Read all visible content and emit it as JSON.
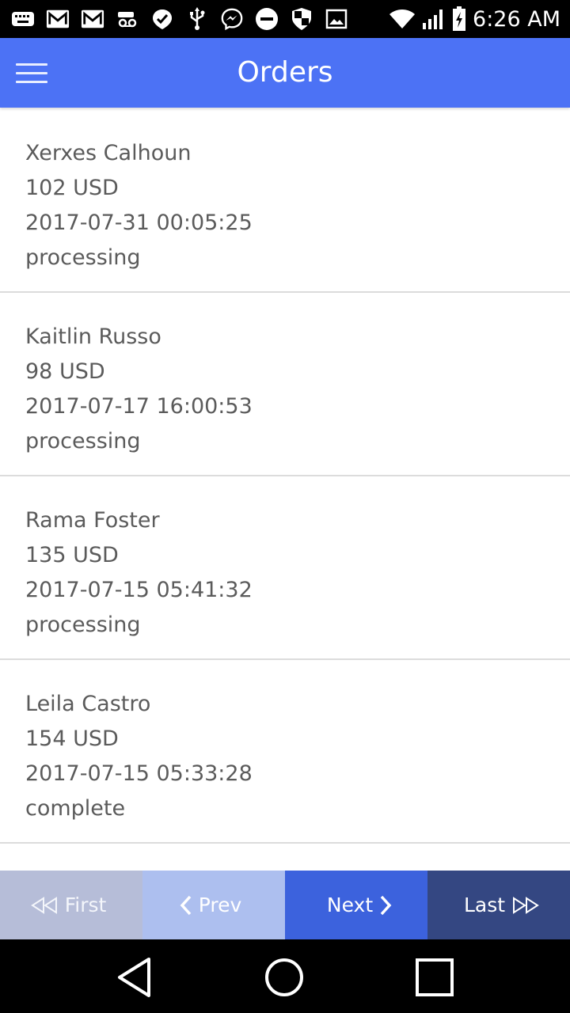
{
  "status_bar": {
    "time": "6:26 AM",
    "icons_left": [
      "keyboard-icon",
      "gmail-icon",
      "gmail-icon",
      "voicemail-icon",
      "check-shield-icon",
      "usb-icon",
      "messenger-icon",
      "do-not-disturb-icon",
      "security-shield-icon",
      "image-icon"
    ],
    "icons_right": [
      "wifi-icon",
      "signal-icon",
      "battery-charging-icon"
    ]
  },
  "app_bar": {
    "title": "Orders",
    "menu_icon": "hamburger-menu-icon",
    "color": "#4c72f5"
  },
  "orders": [
    {
      "name": "Xerxes Calhoun",
      "amount": "102 USD",
      "date": "2017-07-31 00:05:25",
      "status": "processing"
    },
    {
      "name": "Kaitlin Russo",
      "amount": "98 USD",
      "date": "2017-07-17 16:00:53",
      "status": "processing"
    },
    {
      "name": "Rama Foster",
      "amount": "135 USD",
      "date": "2017-07-15 05:41:32",
      "status": "processing"
    },
    {
      "name": "Leila Castro",
      "amount": "154 USD",
      "date": "2017-07-15 05:33:28",
      "status": "complete"
    }
  ],
  "pagination": {
    "first": "First",
    "prev": "Prev",
    "next": "Next",
    "last": "Last",
    "colors": {
      "first": "#b6bdd8",
      "prev": "#adbfef",
      "next": "#3c62dd",
      "last": "#344782"
    }
  },
  "nav_bar": {
    "icons": [
      "back-triangle-icon",
      "home-circle-icon",
      "recents-square-icon"
    ]
  }
}
